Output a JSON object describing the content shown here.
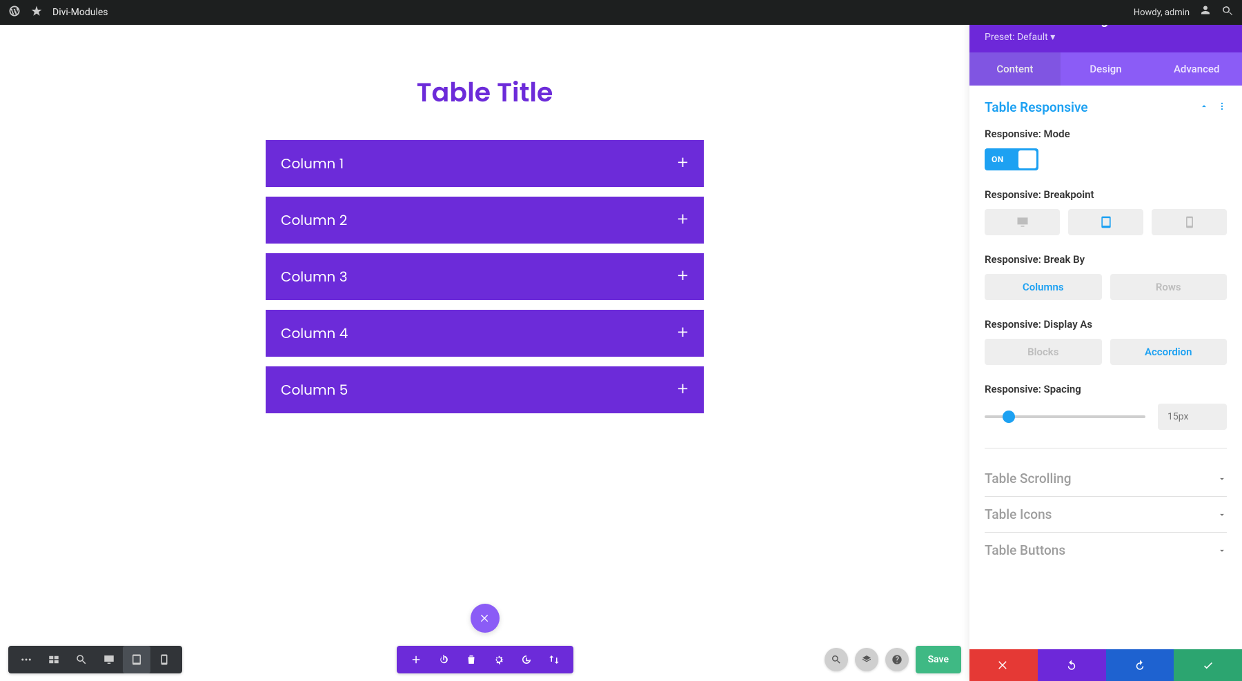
{
  "adminbar": {
    "site_name": "Divi-Modules",
    "howdy": "Howdy, admin"
  },
  "canvas": {
    "table_title": "Table Title",
    "columns": [
      "Column 1",
      "Column 2",
      "Column 3",
      "Column 4",
      "Column 5"
    ]
  },
  "builder_toolbar": {
    "save_label": "Save"
  },
  "sidebar": {
    "title": "Table Maker Settings",
    "preset": "Preset: Default",
    "tabs": {
      "content": "Content",
      "design": "Design",
      "advanced": "Advanced",
      "active": "content"
    },
    "section_open": "Table Responsive",
    "fields": {
      "mode": {
        "label": "Responsive: Mode",
        "state": "ON"
      },
      "breakpoint": {
        "label": "Responsive: Breakpoint",
        "active": "tablet"
      },
      "break_by": {
        "label": "Responsive: Break By",
        "options": [
          "Columns",
          "Rows"
        ],
        "active": "Columns"
      },
      "display_as": {
        "label": "Responsive: Display As",
        "options": [
          "Blocks",
          "Accordion"
        ],
        "active": "Accordion"
      },
      "spacing": {
        "label": "Responsive: Spacing",
        "value": "15px",
        "percent": 15
      }
    },
    "collapsed_sections": [
      "Table Scrolling",
      "Table Icons",
      "Table Buttons"
    ]
  }
}
